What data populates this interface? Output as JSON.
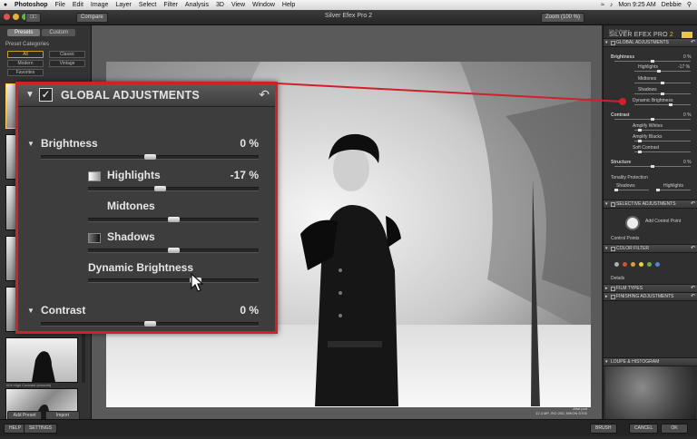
{
  "menubar": {
    "apple": "",
    "items": [
      "Photoshop",
      "File",
      "Edit",
      "Image",
      "Layer",
      "Select",
      "Filter",
      "Analysis",
      "3D",
      "View",
      "Window",
      "Help"
    ],
    "clock": "Mon 9:25 AM",
    "user": "Debbie"
  },
  "titlebar": {
    "title": "Silver Efex Pro 2",
    "compare": "Compare",
    "zoom": "Zoom (100 %)"
  },
  "left_panel": {
    "tabs": [
      "Presets",
      "Custom"
    ],
    "heading": "Preset Categories",
    "categories": [
      "All",
      "Classic",
      "Modern",
      "Vintage",
      "Favorites"
    ],
    "thumb_caption": "004 High Contrast (smooth)",
    "add_preset": "Add Preset",
    "import": "Import"
  },
  "photo_info": {
    "line1": "Alfat pod",
    "line2": "12.4 MP, ISO 200, NIKON D700"
  },
  "right_panel": {
    "brand_small": "Nik Software",
    "brand_main": "SILVER EFEX PRO",
    "brand_num": "2",
    "sections": {
      "global": "GLOBAL ADJUSTMENTS",
      "selective": "SELECTIVE ADJUSTMENTS",
      "color_filter": "COLOR FILTER",
      "film_types": "FILM TYPES",
      "finishing": "FINISHING ADJUSTMENTS",
      "loupe": "LOUPE & HISTOGRAM"
    },
    "brightness": "Brightness",
    "brightness_val": "0 %",
    "highlights": "Highlights",
    "highlights_val": "-17 %",
    "midtones": "Midtones",
    "shadows": "Shadows",
    "dynamic_brightness": "Dynamic Brightness",
    "contrast": "Contrast",
    "contrast_val": "0 %",
    "amplify_whites": "Amplify Whites",
    "amplify_blacks": "Amplify Blacks",
    "soft_contrast": "Soft Contrast",
    "structure": "Structure",
    "structure_val": "0 %",
    "tonality": "Tonality Protection",
    "tp_shadows": "Shadows",
    "tp_highlights": "Highlights",
    "add_control_point": "Add Control Point",
    "control_points": "Control Points",
    "details": "Details",
    "filter_colors": [
      "#b0b0b0",
      "#d0503a",
      "#e0a030",
      "#e8d040",
      "#6ab04a",
      "#4a8ad0"
    ]
  },
  "bottombar": {
    "help": "HELP",
    "settings": "SETTINGS",
    "brush": "BRUSH",
    "cancel": "CANCEL",
    "ok": "OK"
  },
  "callout": {
    "title": "GLOBAL ADJUSTMENTS",
    "brightness": "Brightness",
    "brightness_val": "0 %",
    "brightness_pos": 0.5,
    "highlights": "Highlights",
    "highlights_val": "-17 %",
    "highlights_pos": 0.42,
    "midtones": "Midtones",
    "midtones_pos": 0.5,
    "shadows": "Shadows",
    "shadows_pos": 0.5,
    "dynamic_brightness": "Dynamic Brightness",
    "dynamic_pos": 0.63,
    "contrast": "Contrast",
    "contrast_val": "0 %",
    "contrast_pos": 0.5,
    "accent": "#d0202c"
  }
}
